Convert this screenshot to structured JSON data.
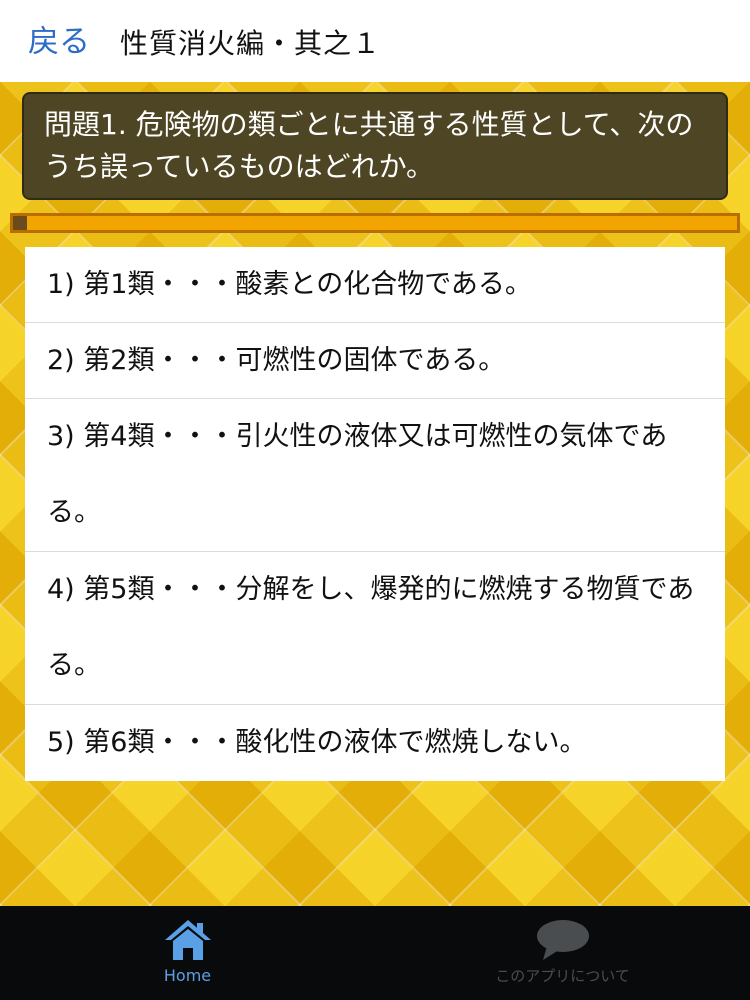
{
  "header": {
    "back_label": "戻る",
    "title": "性質消火編・其之１"
  },
  "question": {
    "text": "問題1. 危険物の類ごとに共通する性質として、次のうち誤っているものはどれか。"
  },
  "progress": {
    "fraction": 0.02
  },
  "answers": [
    {
      "text": "1) 第1類・・・酸素との化合物である。"
    },
    {
      "text": "2) 第2類・・・可燃性の固体である。"
    },
    {
      "text": "3) 第4類・・・引火性の液体又は可燃性の気体である。"
    },
    {
      "text": "4) 第5類・・・分解をし、爆発的に燃焼する物質である。"
    },
    {
      "text": "5) 第6類・・・酸化性の液体で燃焼しない。"
    }
  ],
  "bottom_nav": {
    "home_label": "Home",
    "home_icon": "home-icon",
    "about_label": "このアプリについて",
    "about_icon": "speech-bubble-icon",
    "active_color": "#5aa0e6",
    "inactive_color": "#4a4d50"
  }
}
